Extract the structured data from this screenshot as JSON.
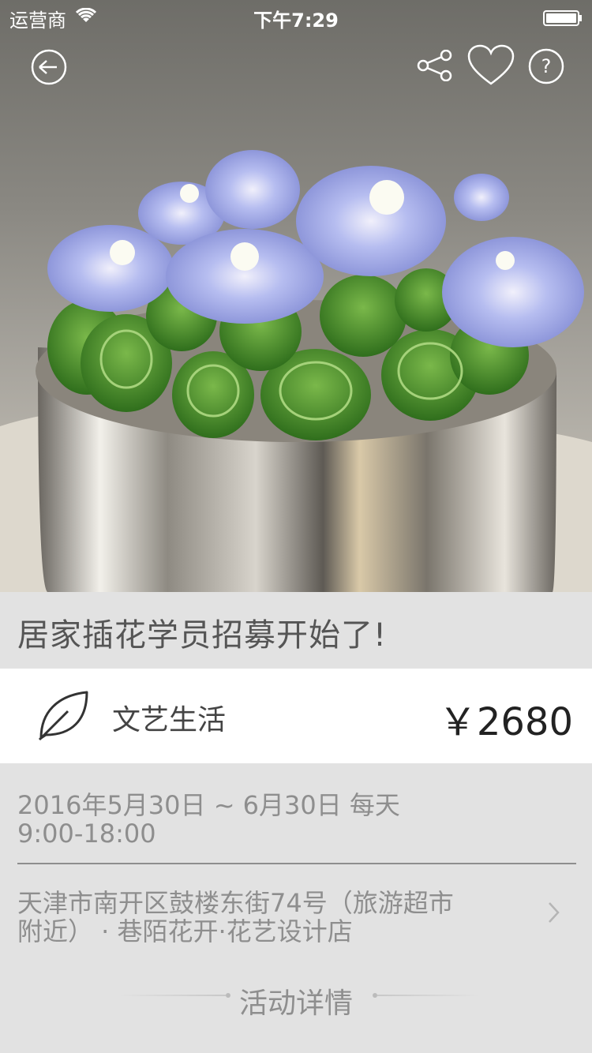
{
  "status_bar": {
    "carrier": "运营商",
    "time": "下午7:29",
    "wifi_icon": "wifi-icon",
    "battery_icon": "battery-icon"
  },
  "nav": {
    "back_icon": "back-arrow-icon",
    "share_icon": "share-icon",
    "favorite_icon": "heart-icon",
    "help_icon": "help-icon"
  },
  "hero": {
    "image": "flower-arrangement-photo"
  },
  "event": {
    "title": "居家插花学员招募开始了!",
    "category": "文艺生活",
    "category_icon": "leaf-icon",
    "price": "￥2680",
    "date_line1": "2016年5月30日 ~ 6月30日 每天",
    "date_line2": "9:00-18:00",
    "address_line1": "天津市南开区鼓楼东街74号（旅游超市",
    "address_line2": "附近） · 巷陌花开·花艺设计店",
    "section_label": "活动详情"
  },
  "colors": {
    "background": "#e2e2e2",
    "card": "#ffffff",
    "muted_text": "#8e8e8e",
    "title_text": "#555555"
  }
}
